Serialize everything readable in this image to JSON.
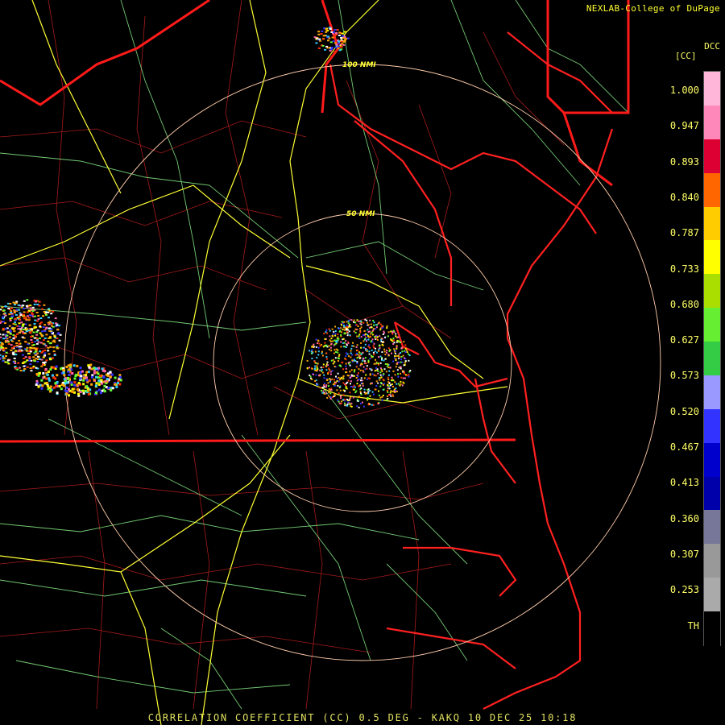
{
  "credit": "NEXLAB-College of DuPage",
  "footer": "CORRELATION COEFFICIENT (CC) 0.5 DEG - KAKQ 10 DEC 25 10:18",
  "legend": {
    "code": "DCC",
    "unit": "[CC]",
    "labels": [
      "1.000",
      "0.947",
      "0.893",
      "0.840",
      "0.787",
      "0.733",
      "0.680",
      "0.627",
      "0.573",
      "0.520",
      "0.467",
      "0.413",
      "0.360",
      "0.307",
      "0.253",
      "TH"
    ],
    "colors": [
      "#ffb6d9",
      "#ff88bb",
      "#dd0033",
      "#ff6600",
      "#ffcc00",
      "#ffff00",
      "#aadd00",
      "#66ee33",
      "#33cc44",
      "#9999ff",
      "#3333ff",
      "#0000cc",
      "#0000aa",
      "#777799",
      "#999999",
      "#aaaaaa",
      "#000000"
    ]
  },
  "range_rings": [
    "50 NMI",
    "100 NMI"
  ],
  "colors": {
    "state_border": "#ff1a1a",
    "county": "#cc2222",
    "road_major": "#ffff44",
    "road_minor": "#99ff99",
    "ring": "#ffccaa"
  }
}
